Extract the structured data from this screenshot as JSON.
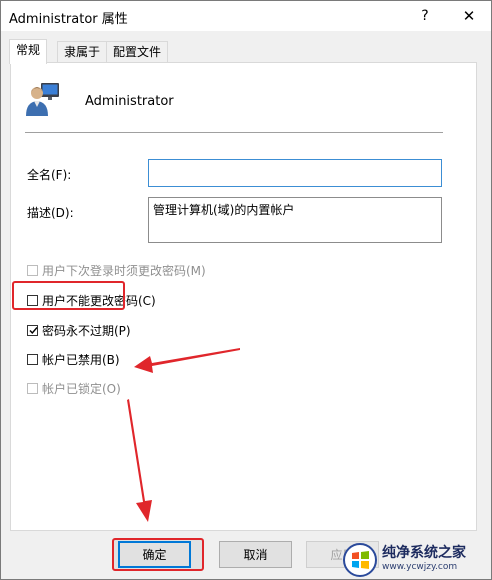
{
  "window": {
    "title": "Administrator 属性",
    "help_glyph": "?",
    "close_glyph": "✕"
  },
  "tabs": [
    {
      "label": "常规",
      "active": true
    },
    {
      "label": "隶属于",
      "active": false
    },
    {
      "label": "配置文件",
      "active": false
    }
  ],
  "general": {
    "user_name": "Administrator",
    "fullname_label": "全名(F):",
    "fullname_value": "",
    "description_label": "描述(D):",
    "description_value": "管理计算机(域)的内置帐户",
    "checkboxes": [
      {
        "label": "用户下次登录时须更改密码(M)",
        "checked": false,
        "enabled": false
      },
      {
        "label": "用户不能更改密码(C)",
        "checked": false,
        "enabled": true
      },
      {
        "label": "密码永不过期(P)",
        "checked": true,
        "enabled": true
      },
      {
        "label": "帐户已禁用(B)",
        "checked": false,
        "enabled": true
      },
      {
        "label": "帐户已锁定(O)",
        "checked": false,
        "enabled": false
      }
    ]
  },
  "buttons": {
    "ok": "确定",
    "cancel": "取消",
    "apply": "应用"
  },
  "annotation_color": "#e0262b",
  "watermark": {
    "main": "纯净系统之家",
    "sub": "www.ycwjzy.com"
  }
}
